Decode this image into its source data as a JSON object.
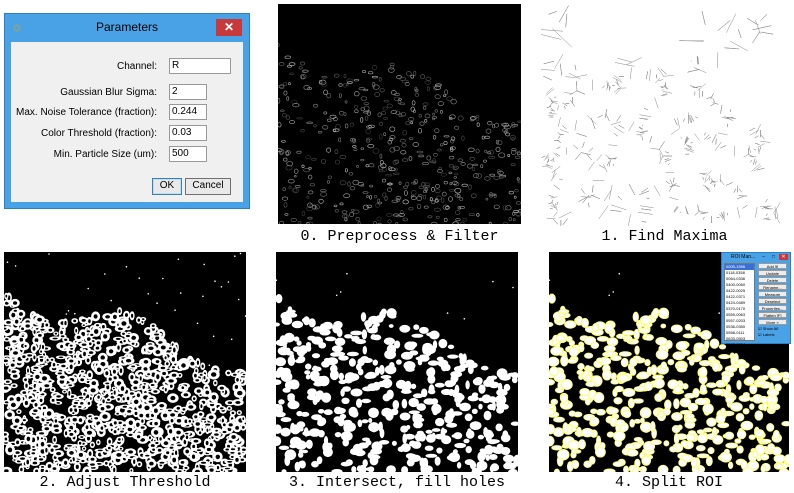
{
  "dialog": {
    "title": "Parameters",
    "close_glyph": "✕",
    "app_icon_glyph": "☼",
    "fields": [
      {
        "label": "Channel:",
        "value": "R"
      },
      {
        "label": "Gaussian Blur Sigma:",
        "value": "2"
      },
      {
        "label": "Max. Noise Tolerance (fraction):",
        "value": "0.244"
      },
      {
        "label": "Color Threshold (fraction):",
        "value": "0.03"
      },
      {
        "label": "Min. Particle Size (um):",
        "value": "500"
      }
    ],
    "ok_label": "OK",
    "cancel_label": "Cancel"
  },
  "captions": {
    "preprocess": "0. Preprocess & Filter",
    "maxima": "1. Find Maxima",
    "threshold": "2. Adjust Threshold",
    "intersect": "3. Intersect, fill holes",
    "split": "4. Split ROI"
  },
  "roi_manager": {
    "title": "ROI Man...",
    "ctrl_min": "–",
    "ctrl_max": "□",
    "ctrl_close": "✕",
    "items": [
      "0005-1596",
      "0118-0358",
      "0064-0336",
      "0400-0060",
      "0422-0025",
      "0422-0371",
      "0424-0489",
      "0370-0170",
      "0559-0063",
      "0557-0203",
      "0536-0350",
      "0558-0111",
      "0633-0503",
      "0577-0734"
    ],
    "buttons": [
      "Add [t]",
      "Update",
      "Delete",
      "Rename...",
      "Measure",
      "Deselect",
      "Properties...",
      "Flatten [F]",
      "More »"
    ],
    "show_all": "Show All",
    "labels": "Labels"
  },
  "colors": {
    "dialog_frame": "#4aa2e6",
    "close_red": "#c7393a",
    "roi_overlay": "#ffff66"
  }
}
